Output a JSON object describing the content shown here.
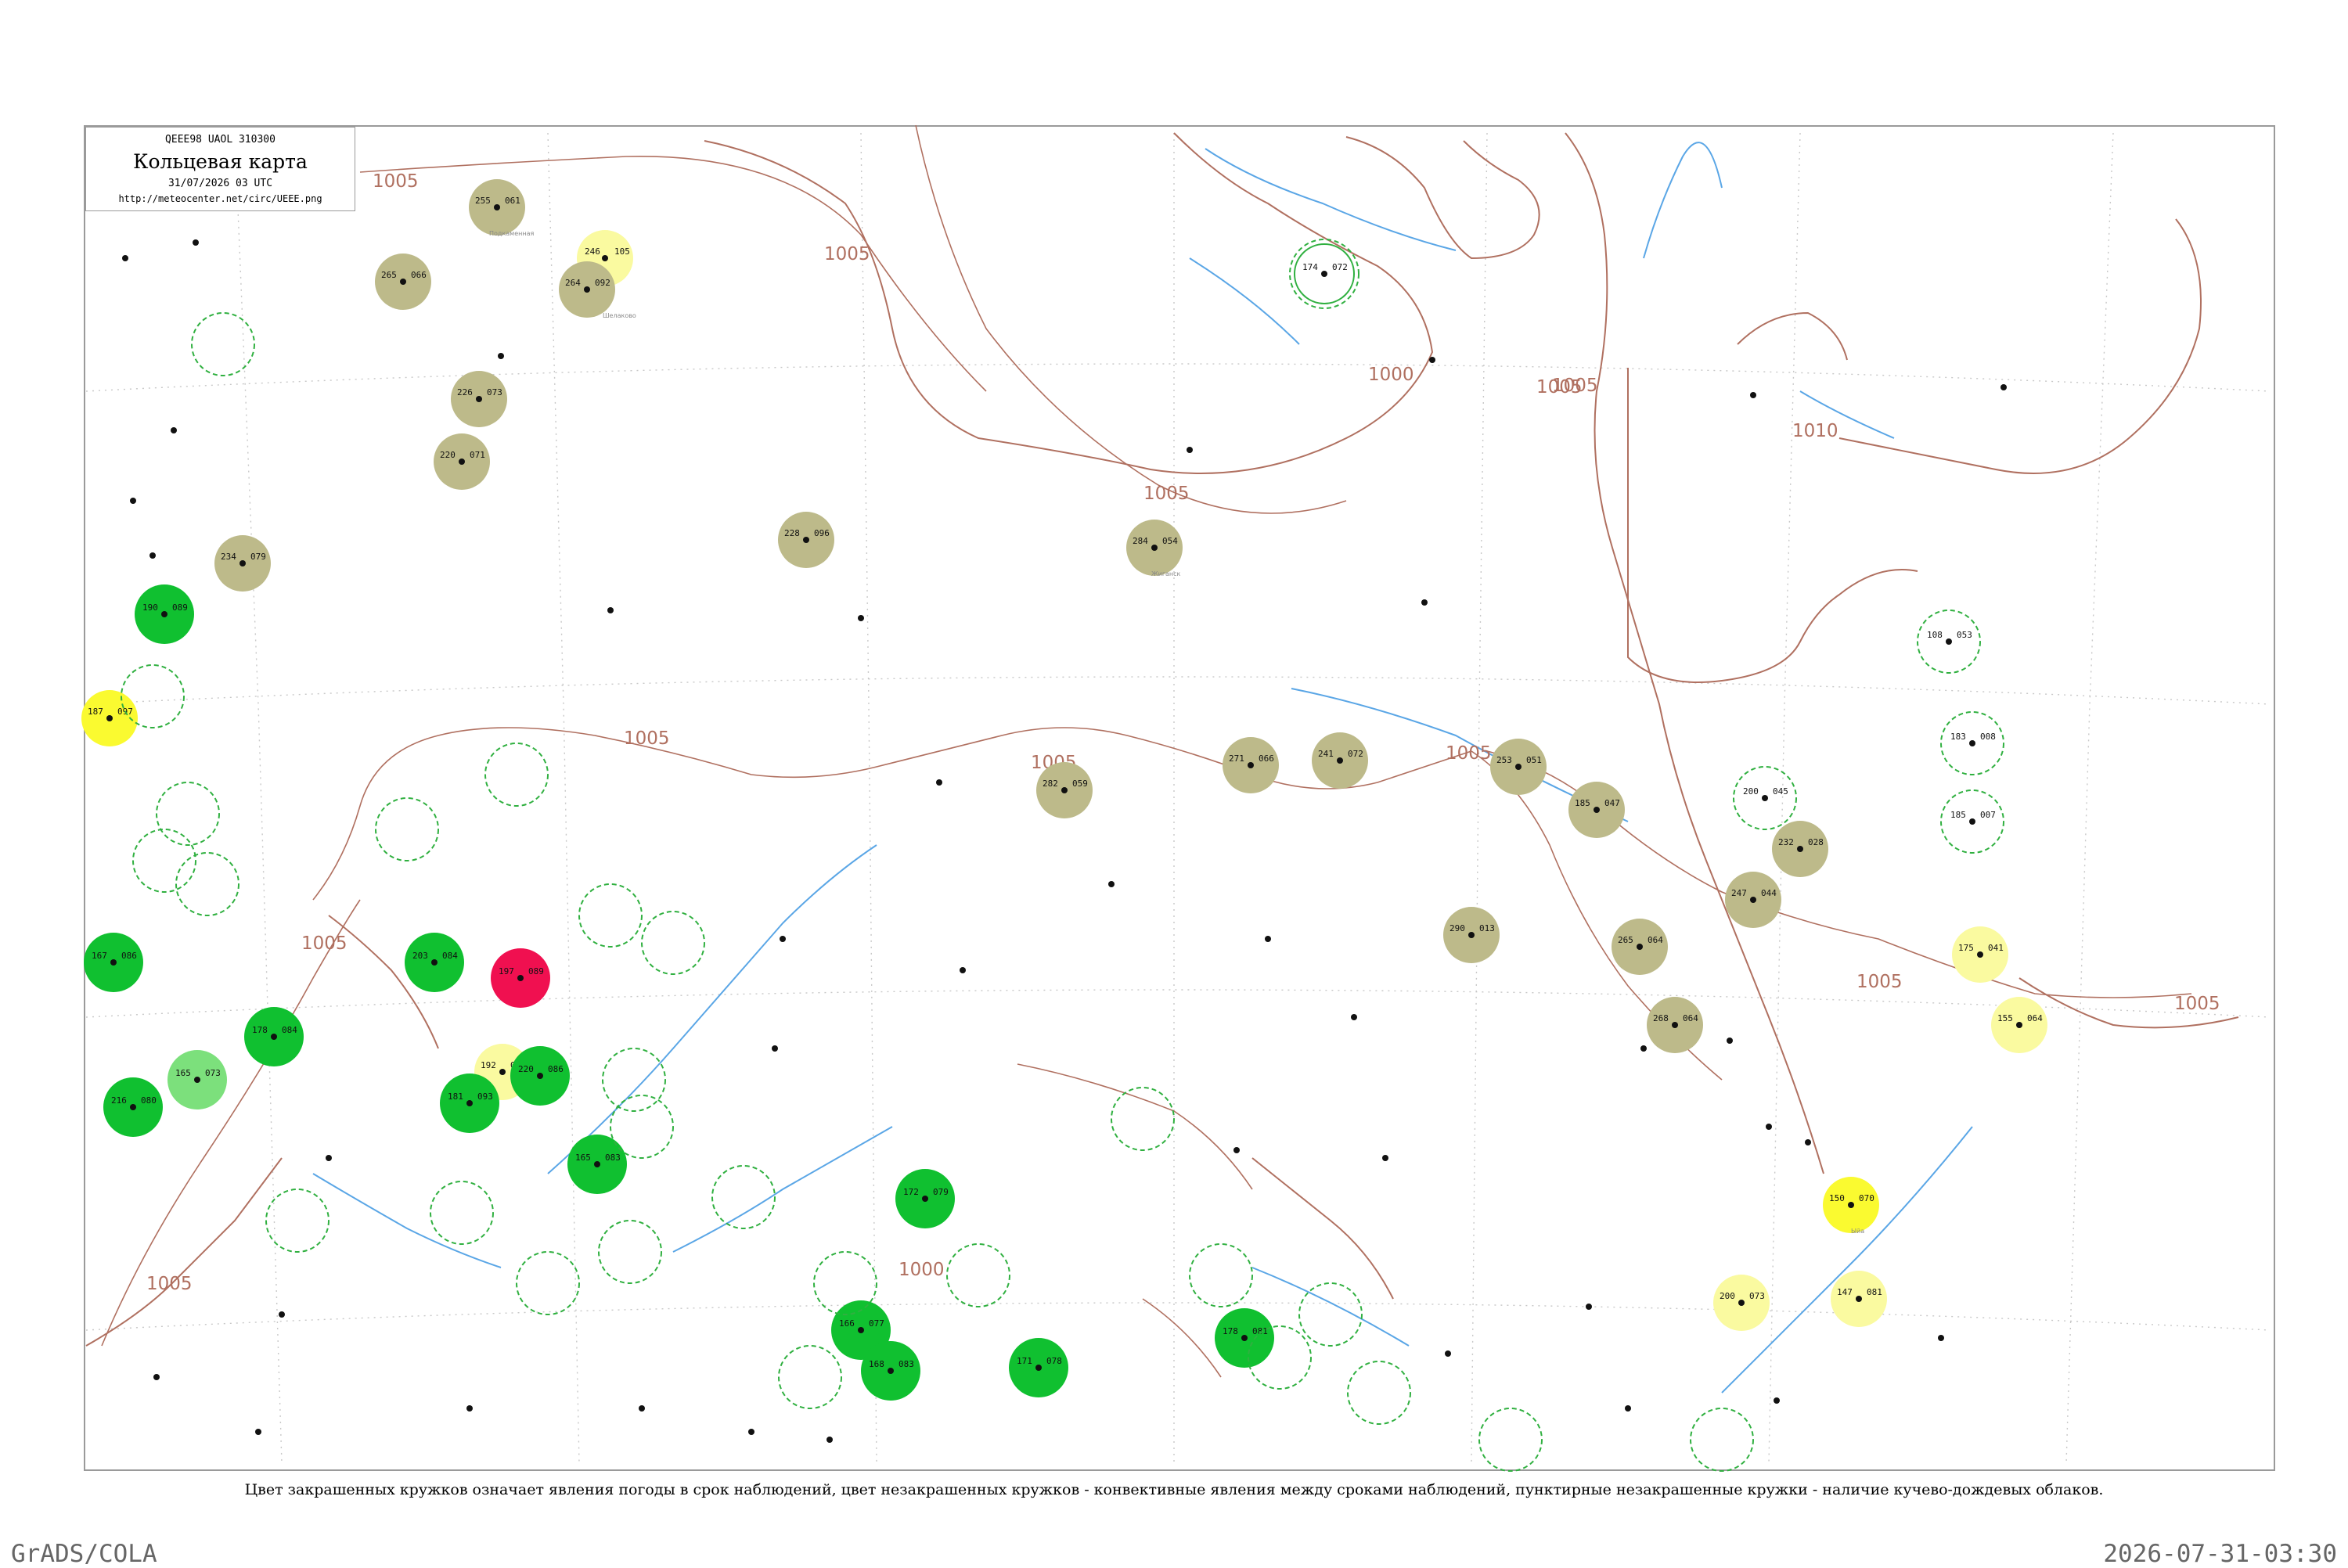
{
  "header": {
    "code": "QEEE98  UAOL  310300",
    "title": "Кольцевая карта",
    "date": "31/07/2026 03 UTC",
    "url": "http://meteocenter.net/circ/UEEE.png"
  },
  "caption": "Цвет закрашенных кружков означает явления погоды в срок наблюдений, цвет незакрашенных кружков - конвективные явления между сроками наблюдений, пунктирные незакрашенные кружки - наличие кучево-дождевых облаков.",
  "footer": {
    "left": "GrADS/COLA",
    "right": "2026-07-31-03:30"
  },
  "colors": {
    "isobar": "#b07060",
    "river": "#5aa6e6",
    "olive": "#bdba8a",
    "green": "#10c030",
    "light_green": "#7ce07c",
    "yellow": "#fafa30",
    "pale_yellow": "#fafaa0",
    "red": "#f01050",
    "dashed_ring": "#30b040"
  },
  "isobar_labels": [
    "1005",
    "1005",
    "1000",
    "1005",
    "1005",
    "1005",
    "1010",
    "1005",
    "1005",
    "1005",
    "1005",
    "1005",
    "1005",
    "1005",
    "1000"
  ],
  "stations": [
    {
      "p": "255",
      "t": "061",
      "n": "Подкаменная",
      "c": "olive"
    },
    {
      "p": "265",
      "t": "066",
      "n": "",
      "c": "olive"
    },
    {
      "p": "246",
      "t": "105",
      "n": "",
      "c": "pale_yellow"
    },
    {
      "p": "264",
      "t": "092",
      "n": "Шелаково",
      "c": "olive"
    },
    {
      "p": "226",
      "t": "073",
      "n": "",
      "c": "olive"
    },
    {
      "p": "220",
      "t": "071",
      "n": "",
      "c": "olive"
    },
    {
      "p": "228",
      "t": "096",
      "n": "",
      "c": "olive"
    },
    {
      "p": "284",
      "t": "054",
      "n": "Жиганск",
      "c": "olive"
    },
    {
      "p": "234",
      "t": "079",
      "n": "",
      "c": "olive"
    },
    {
      "p": "187",
      "t": "097",
      "n": "",
      "c": "yellow"
    },
    {
      "p": "282",
      "t": "059",
      "n": "",
      "c": "olive"
    },
    {
      "p": "271",
      "t": "066",
      "n": "",
      "c": "olive"
    },
    {
      "p": "241",
      "t": "072",
      "n": "",
      "c": "olive"
    },
    {
      "p": "253",
      "t": "051",
      "n": "",
      "c": "olive"
    },
    {
      "p": "185",
      "t": "047",
      "n": "",
      "c": "olive"
    },
    {
      "p": "232",
      "t": "028",
      "n": "",
      "c": "olive"
    },
    {
      "p": "247",
      "t": "044",
      "n": "",
      "c": "olive"
    },
    {
      "p": "290",
      "t": "013",
      "n": "",
      "c": "olive"
    },
    {
      "p": "265",
      "t": "064",
      "n": "",
      "c": "olive"
    },
    {
      "p": "268",
      "t": "064",
      "n": "",
      "c": "olive"
    },
    {
      "p": "175",
      "t": "041",
      "n": "",
      "c": "pale_yellow"
    },
    {
      "p": "155",
      "t": "064",
      "n": "",
      "c": "pale_yellow"
    },
    {
      "p": "150",
      "t": "070",
      "n": "Ыйа",
      "c": "yellow"
    },
    {
      "p": "200",
      "t": "073",
      "n": "",
      "c": "pale_yellow"
    },
    {
      "p": "147",
      "t": "081",
      "n": "",
      "c": "pale_yellow"
    },
    {
      "p": "167",
      "t": "086",
      "n": "",
      "c": "green"
    },
    {
      "p": "190",
      "t": "089",
      "n": "",
      "c": "green"
    },
    {
      "p": "165",
      "t": "073",
      "n": "",
      "c": "light_green"
    },
    {
      "p": "216",
      "t": "080",
      "n": "",
      "c": "green"
    },
    {
      "p": "178",
      "t": "084",
      "n": "",
      "c": "green"
    },
    {
      "p": "197",
      "t": "089",
      "n": "",
      "c": "red"
    },
    {
      "p": "192",
      "t": "088",
      "n": "",
      "c": "pale_yellow"
    },
    {
      "p": "203",
      "t": "084",
      "n": "",
      "c": "green"
    },
    {
      "p": "181",
      "t": "093",
      "n": "",
      "c": "green"
    },
    {
      "p": "220",
      "t": "086",
      "n": "",
      "c": "green"
    },
    {
      "p": "165",
      "t": "083",
      "n": "",
      "c": "green"
    },
    {
      "p": "172",
      "t": "079",
      "n": "",
      "c": "green"
    },
    {
      "p": "166",
      "t": "077",
      "n": "",
      "c": "green"
    },
    {
      "p": "168",
      "t": "083",
      "n": "",
      "c": "green"
    },
    {
      "p": "171",
      "t": "078",
      "n": "",
      "c": "green"
    },
    {
      "p": "178",
      "t": "081",
      "n": "",
      "c": "green"
    },
    {
      "p": "174",
      "t": "072",
      "n": "",
      "c": "ring"
    },
    {
      "p": "108",
      "t": "053",
      "n": "",
      "c": "ring"
    },
    {
      "p": "200",
      "t": "045",
      "n": "",
      "c": "ring"
    },
    {
      "p": "185",
      "t": "007",
      "n": "",
      "c": "ring"
    },
    {
      "p": "183",
      "t": "008",
      "n": "",
      "c": "ring"
    }
  ]
}
